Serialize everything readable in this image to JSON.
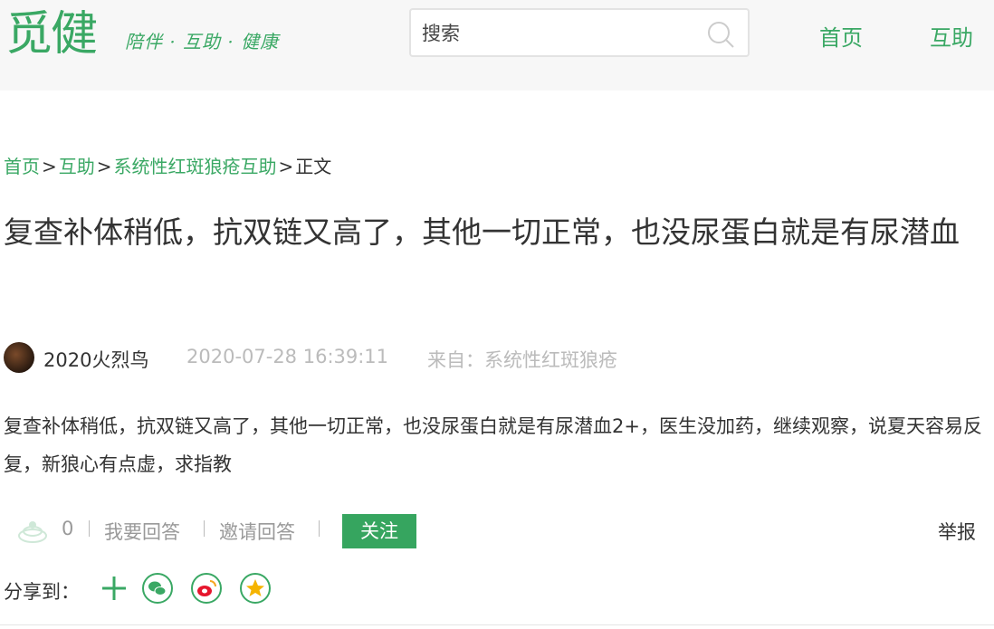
{
  "header": {
    "logo_text": "觅健",
    "slogan": "陪伴 · 互助 · 健康",
    "search_placeholder": "搜索",
    "nav": [
      {
        "label": "首页"
      },
      {
        "label": "互助"
      }
    ]
  },
  "breadcrumb": {
    "items": [
      "首页",
      "互助",
      "系统性红斑狼疮互助"
    ],
    "current": "正文",
    "separator": ">"
  },
  "post": {
    "title": "复查补体稍低，抗双链又高了，其他一切正常，也没尿蛋白就是有尿潜血",
    "author": "2020火烈鸟",
    "time": "2020-07-28 16:39:11",
    "from": "来自：系统性红斑狼疮",
    "content": "复查补体稍低，抗双链又高了，其他一切正常，也没尿蛋白就是有尿潜血2+，医生没加药，继续观察，说夏天容易反复，新狼心有点虚，求指教"
  },
  "actions": {
    "like_count": "0",
    "answer": "我要回答",
    "invite": "邀请回答",
    "follow": "关注",
    "report": "举报"
  },
  "share": {
    "label": "分享到："
  },
  "colors": {
    "brand_green": "#3aa864",
    "button_green": "#36a55f",
    "muted": "#bbbbbb"
  }
}
